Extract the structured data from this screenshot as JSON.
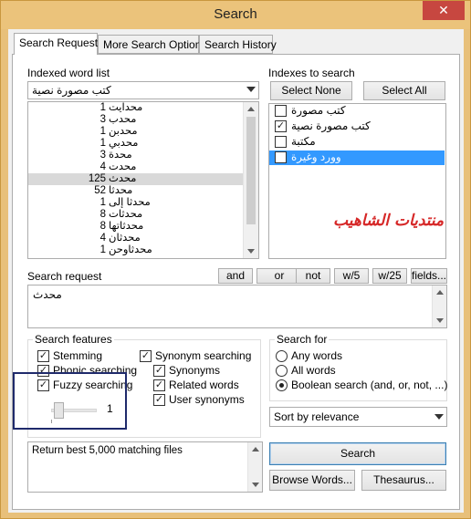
{
  "window": {
    "title": "Search",
    "close": "✕"
  },
  "tabs": [
    {
      "label": "Search Request"
    },
    {
      "label": "More Search Options"
    },
    {
      "label": "Search History"
    }
  ],
  "indexed_word_list": {
    "label": "Indexed word list",
    "selected_index": "كتب مصورة نصية",
    "rows": [
      {
        "count": "1",
        "word": "محدايت"
      },
      {
        "count": "3",
        "word": "محدب"
      },
      {
        "count": "1",
        "word": "محدبن"
      },
      {
        "count": "1",
        "word": "محدبي"
      },
      {
        "count": "3",
        "word": "محدة"
      },
      {
        "count": "4",
        "word": "محدت"
      },
      {
        "count": "125",
        "word": "محدث"
      },
      {
        "count": "52",
        "word": "محدثا"
      },
      {
        "count": "1",
        "word": "محدثا إلى"
      },
      {
        "count": "8",
        "word": "محدثات"
      },
      {
        "count": "8",
        "word": "محدثاتها"
      },
      {
        "count": "4",
        "word": "محدثان"
      },
      {
        "count": "1",
        "word": "محدثاوحن"
      }
    ]
  },
  "indexes": {
    "label": "Indexes to search",
    "select_none": "Select None",
    "select_all": "Select All",
    "items": [
      {
        "name": "كتب مصورة",
        "checked": ""
      },
      {
        "name": "كتب مصورة نصية",
        "checked": "✓"
      },
      {
        "name": "مكتبة",
        "checked": ""
      },
      {
        "name": "وورد وغيرة",
        "checked": ""
      }
    ],
    "watermark": "منتديات الشاهيب"
  },
  "search_request": {
    "label": "Search request",
    "value": "محدث",
    "operators": [
      "and",
      "or",
      "not",
      "w/5",
      "w/25",
      "fields..."
    ]
  },
  "search_features": {
    "title": "Search features",
    "stemming": {
      "label": "Stemming",
      "checked": "✓"
    },
    "phonic": {
      "label": "Phonic searching",
      "checked": "✓"
    },
    "fuzzy": {
      "label": "Fuzzy searching",
      "checked": "✓",
      "level": "1"
    },
    "synonym_searching": {
      "label": "Synonym searching",
      "checked": "✓"
    },
    "synonyms": {
      "label": "Synonyms",
      "checked": "✓"
    },
    "related": {
      "label": "Related words",
      "checked": "✓"
    },
    "user_synonyms": {
      "label": "User synonyms",
      "checked": "✓"
    }
  },
  "search_for": {
    "title": "Search for",
    "any": "Any words",
    "all": "All words",
    "boolean": "Boolean search (and, or, not, ...)"
  },
  "sort": {
    "value": "Sort by relevance"
  },
  "result_text": "Return best 5,000 matching files",
  "buttons": {
    "search": "Search",
    "browse": "Browse Words...",
    "thesaurus": "Thesaurus..."
  },
  "colors": {
    "accent": "#3399ff",
    "title_bar": "#ebc37b",
    "close": "#c74740",
    "highlight_box": "#1f2a6b",
    "watermark": "#d62828"
  }
}
